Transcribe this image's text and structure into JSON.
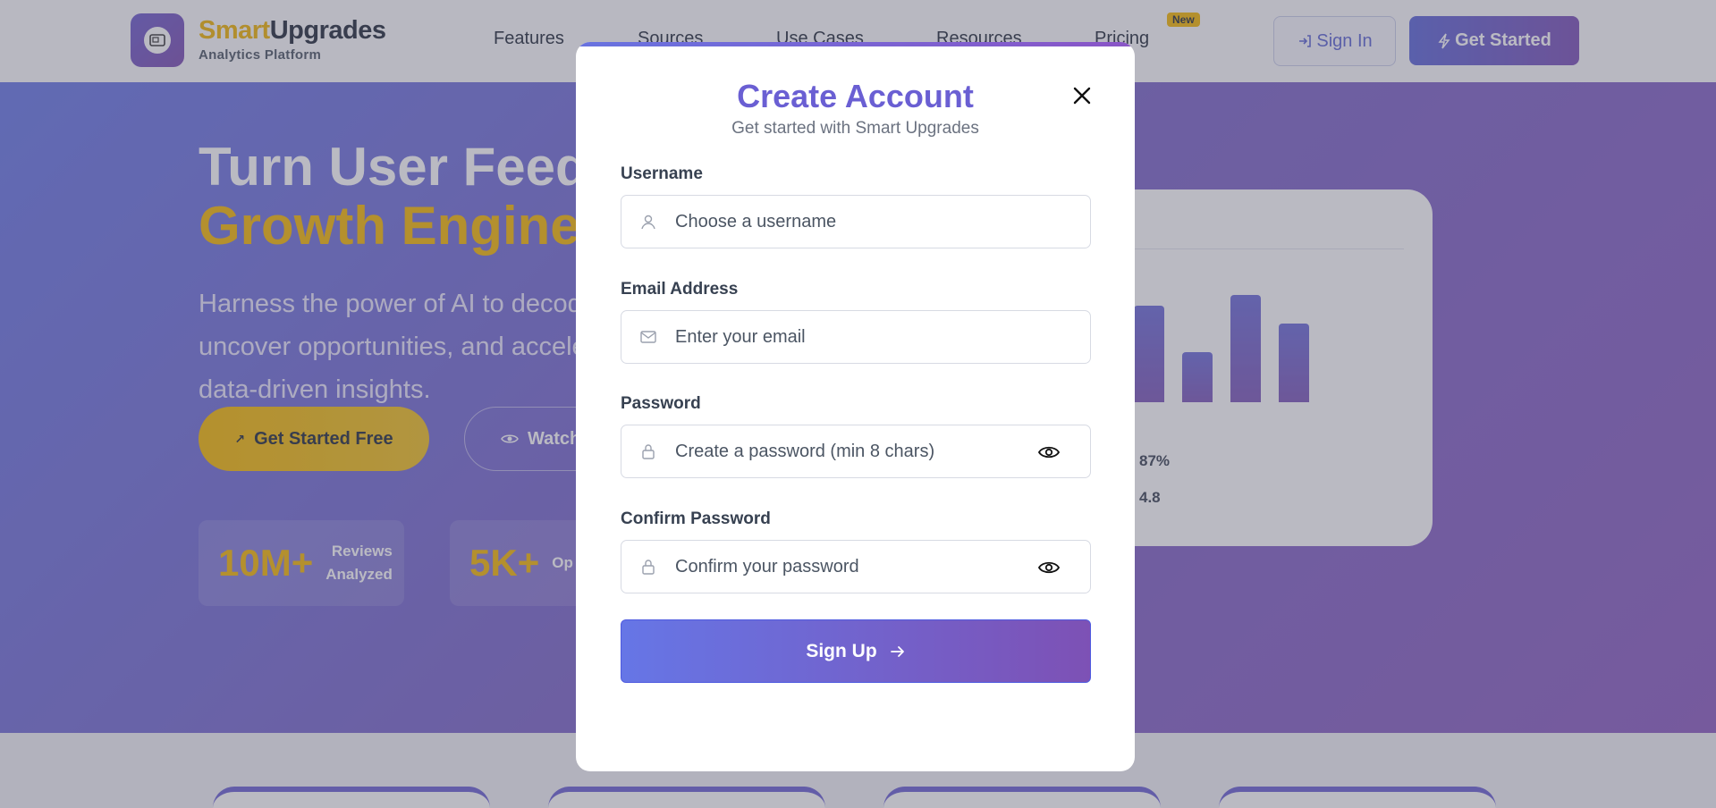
{
  "nav": {
    "brand_part1": "Smart",
    "brand_part2": "Upgrades",
    "brand_sub": "Analytics Platform",
    "links": [
      "Features",
      "Sources",
      "Use Cases",
      "Resources",
      "Pricing"
    ],
    "badge": "New",
    "sign_in": "Sign In",
    "get_started": "Get Started"
  },
  "hero": {
    "title_line1": "Turn User Feedback into",
    "title_line2": "Growth Engine",
    "subtitle": "Harness the power of AI to decode user feedback, uncover opportunities, and accelerate your product with data-driven insights.",
    "cta_primary": "Get Started Free",
    "cta_secondary": "Watch Demo",
    "stats": [
      {
        "num": "10M+",
        "label_1": "Reviews",
        "label_2": "Analyzed"
      },
      {
        "num": "5K+",
        "label_1": "",
        "label_2": "Op"
      }
    ],
    "dashboard_values": [
      "87%",
      "4.8"
    ]
  },
  "modal": {
    "title": "Create Account",
    "subtitle": "Get started with Smart Upgrades",
    "username_label": "Username",
    "username_placeholder": "Choose a username",
    "email_label": "Email Address",
    "email_placeholder": "Enter your email",
    "password_label": "Password",
    "password_placeholder": "Create a password (min 8 chars)",
    "confirm_label": "Confirm Password",
    "confirm_placeholder": "Confirm your password",
    "submit": "Sign Up"
  },
  "colors": {
    "primary": "#6a5fd3",
    "accent": "#f5b700",
    "gradient_start": "#6676e6",
    "gradient_end": "#7d51b5"
  }
}
